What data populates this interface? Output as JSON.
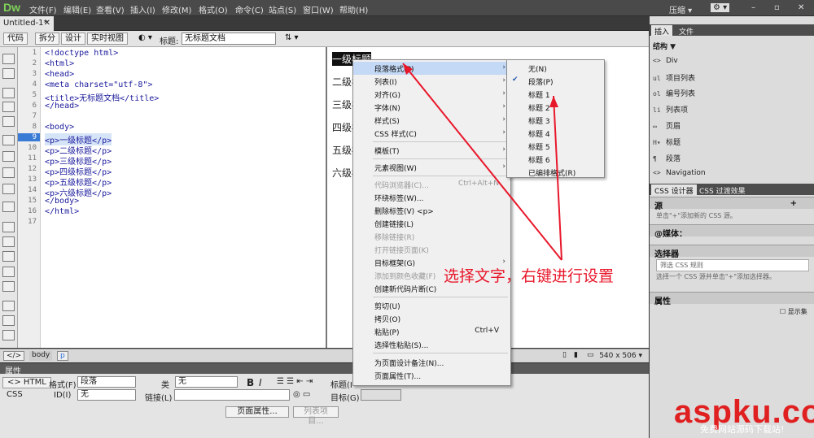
{
  "app": {
    "logo": "Dw",
    "menus": [
      "文件(F)",
      "编辑(E)",
      "查看(V)",
      "插入(I)",
      "修改(M)",
      "格式(O)",
      "命令(C)",
      "站点(S)",
      "窗口(W)",
      "帮助(H)"
    ],
    "compress_label": "压缩 ▾",
    "window_controls": [
      "–",
      "▫",
      "✕"
    ]
  },
  "doc_tab": "Untitled-1*",
  "doc_toolbar": {
    "code": "代码",
    "split": "拆分",
    "design": "设计",
    "live": "实时视图",
    "title_label": "标题:",
    "title_value": "无标题文档"
  },
  "code_lines": [
    {
      "n": "1",
      "t": "<!doctype html>"
    },
    {
      "n": "2",
      "t": "<html>"
    },
    {
      "n": "3",
      "t": "<head>"
    },
    {
      "n": "4",
      "t": "<meta charset=\"utf-8\">"
    },
    {
      "n": "5",
      "t": "<title>无标题文档</title>"
    },
    {
      "n": "6",
      "t": "</head>"
    },
    {
      "n": "7",
      "t": ""
    },
    {
      "n": "8",
      "t": "<body>"
    },
    {
      "n": "9",
      "t": "<p>一级标题</p>"
    },
    {
      "n": "10",
      "t": "<p>二级标题</p>"
    },
    {
      "n": "11",
      "t": "<p>三级标题</p>"
    },
    {
      "n": "12",
      "t": "<p>四级标题</p>"
    },
    {
      "n": "13",
      "t": "<p>五级标题</p>"
    },
    {
      "n": "14",
      "t": "<p>六级标题</p>"
    },
    {
      "n": "15",
      "t": "</body>"
    },
    {
      "n": "16",
      "t": "</html>"
    },
    {
      "n": "17",
      "t": ""
    }
  ],
  "design_lines": [
    "一级标题",
    "二级标",
    "三级标",
    "四级标",
    "五级标",
    "六级标"
  ],
  "status": {
    "tags": [
      "</>",
      "body",
      "p"
    ],
    "size": "540 x 506 ▾"
  },
  "context_menu": [
    {
      "label": "段落格式(P)",
      "arrow": true,
      "hi": true
    },
    {
      "label": "列表(I)",
      "arrow": true
    },
    {
      "label": "对齐(G)",
      "arrow": true
    },
    {
      "label": "字体(N)",
      "arrow": true
    },
    {
      "label": "样式(S)",
      "arrow": true
    },
    {
      "label": "CSS 样式(C)",
      "arrow": true
    },
    {
      "sep": true
    },
    {
      "label": "模板(T)",
      "arrow": true
    },
    {
      "sep": true
    },
    {
      "label": "元素视图(W)",
      "arrow": true
    },
    {
      "sep": true
    },
    {
      "label": "代码浏览器(C)...",
      "dis": true,
      "sc": "Ctrl+Alt+N"
    },
    {
      "label": "环绕标签(W)..."
    },
    {
      "label": "删除标签(V) <p>"
    },
    {
      "label": "创建链接(L)"
    },
    {
      "label": "移除链接(R)",
      "dis": true
    },
    {
      "label": "打开链接页面(K)",
      "dis": true
    },
    {
      "label": "目标框架(G)",
      "arrow": true
    },
    {
      "label": "添加到颜色收藏(F)",
      "dis": true
    },
    {
      "label": "创建新代码片断(C)"
    },
    {
      "sep": true
    },
    {
      "label": "剪切(U)"
    },
    {
      "label": "拷贝(O)"
    },
    {
      "label": "粘贴(P)",
      "sc": "Ctrl+V"
    },
    {
      "label": "选择性粘贴(S)..."
    },
    {
      "sep": true
    },
    {
      "label": "为页面设计备注(N)..."
    },
    {
      "label": "页面属性(T)..."
    }
  ],
  "submenu": [
    "无(N)",
    "段落(P)",
    "标题 1",
    "标题 2",
    "标题 3",
    "标题 4",
    "标题 5",
    "标题 6",
    "已编排格式(R)"
  ],
  "submenu_checked": "段落(P)",
  "annotation": "选择文字，右键进行设置",
  "properties": {
    "header": "属性",
    "html_btn": "<> HTML",
    "css_btn": "CSS",
    "format_label": "格式(F)",
    "format_value": "段落",
    "class_label": "类",
    "class_value": "无",
    "id_label": "ID(I)",
    "id_value": "无",
    "link_label": "链接(L)",
    "title_label": "标题(I",
    "target_label": "目标(G)",
    "page_props": "页面属性...",
    "list_item": "列表项目..."
  },
  "right_panel": {
    "tabs": [
      "插入",
      "文件"
    ],
    "category": "结构 ▼",
    "items": [
      {
        "icon": "<>",
        "label": "Div"
      },
      {
        "icon": "ul",
        "label": "项目列表"
      },
      {
        "icon": "ol",
        "label": "编号列表"
      },
      {
        "icon": "li",
        "label": "列表项"
      },
      {
        "icon": "▭",
        "label": "页眉"
      },
      {
        "icon": "H▾",
        "label": "标题"
      },
      {
        "icon": "¶",
        "label": "段落"
      },
      {
        "icon": "<>",
        "label": "Navigation"
      }
    ],
    "css_tabs": [
      "CSS 设计器",
      "CSS 过渡效果"
    ],
    "sources": "源",
    "sources_hint": "单击\"+\"添加新的 CSS 源。",
    "media": "@媒体：",
    "selectors": "选择器",
    "filter": "筛选 CSS 规则",
    "selectors_hint": "选择一个 CSS 源并单击\"+\"添加选择器。",
    "attributes": "属性",
    "show_set": "显示集"
  },
  "watermark": "aspku.com",
  "watermark_sub": "免费网站源码下载站!"
}
